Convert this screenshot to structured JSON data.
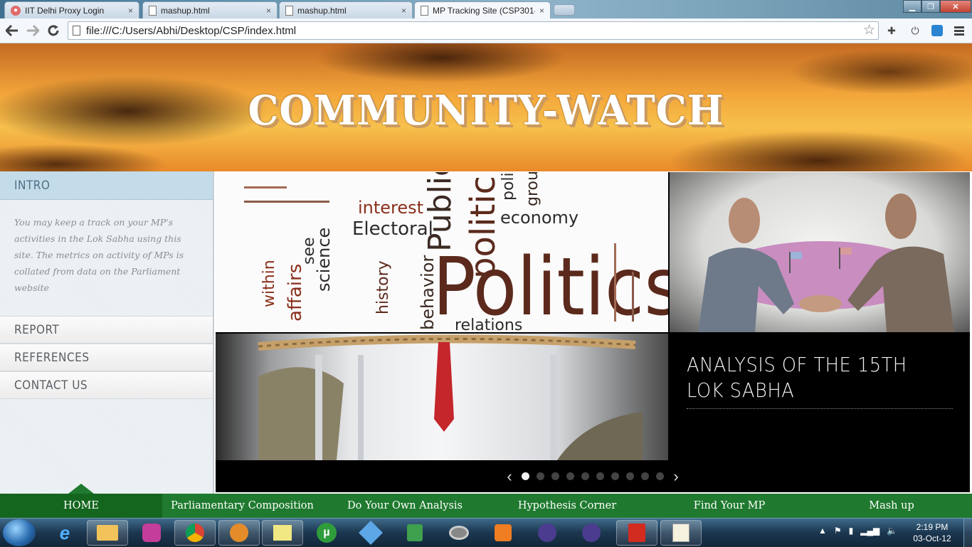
{
  "browser": {
    "tabs": [
      {
        "title": "IIT Delhi Proxy Login",
        "icon": "proxy-favicon",
        "active": false
      },
      {
        "title": "mashup.html",
        "icon": "document-icon",
        "active": false
      },
      {
        "title": "mashup.html",
        "icon": "document-icon",
        "active": false
      },
      {
        "title": "MP Tracking Site (CSP301-",
        "icon": "document-icon",
        "active": true
      }
    ],
    "close_glyph": "×",
    "address": "file:///C:/Users/Abhi/Desktop/CSP/index.html"
  },
  "site": {
    "title": "COMMUNITY-WATCH",
    "sidebar": {
      "heading": "INTRO",
      "intro_text": "You may keep a track on your MP's activities in the Lok Sabha using this site. The metrics on activity of MPs is collated from data on the Parliament website",
      "items": [
        "REPORT",
        "REFERENCES",
        "CONTACT US"
      ]
    },
    "slider": {
      "caption": "ANALYSIS OF THE 15TH LOK SABHA",
      "dot_count": 10,
      "active_dot": 0
    },
    "politics_words": {
      "big": "Politics",
      "public": "Public",
      "politic": "politic",
      "electoral": "Electoral",
      "interest": "interest",
      "economy": "economy",
      "affairs": "affairs",
      "science": "science",
      "history": "history",
      "behavior": "behavior",
      "relations": "relations",
      "within": "within",
      "policy": "policy",
      "group": "group",
      "see": "see"
    },
    "nav": [
      {
        "label": "HOME",
        "active": true
      },
      {
        "label": "Parliamentary Composition",
        "active": false
      },
      {
        "label": "Do Your Own Analysis",
        "active": false
      },
      {
        "label": "Hypothesis Corner",
        "active": false
      },
      {
        "label": "Find Your MP",
        "active": false
      },
      {
        "label": "Mash up",
        "active": false
      }
    ]
  },
  "taskbar": {
    "time": "2:19 PM",
    "date": "03-Oct-12"
  },
  "colors": {
    "nav_green": "#1f7a2f",
    "sidebar_head": "#c4dce9",
    "banner_orange": "#f3a63a"
  }
}
